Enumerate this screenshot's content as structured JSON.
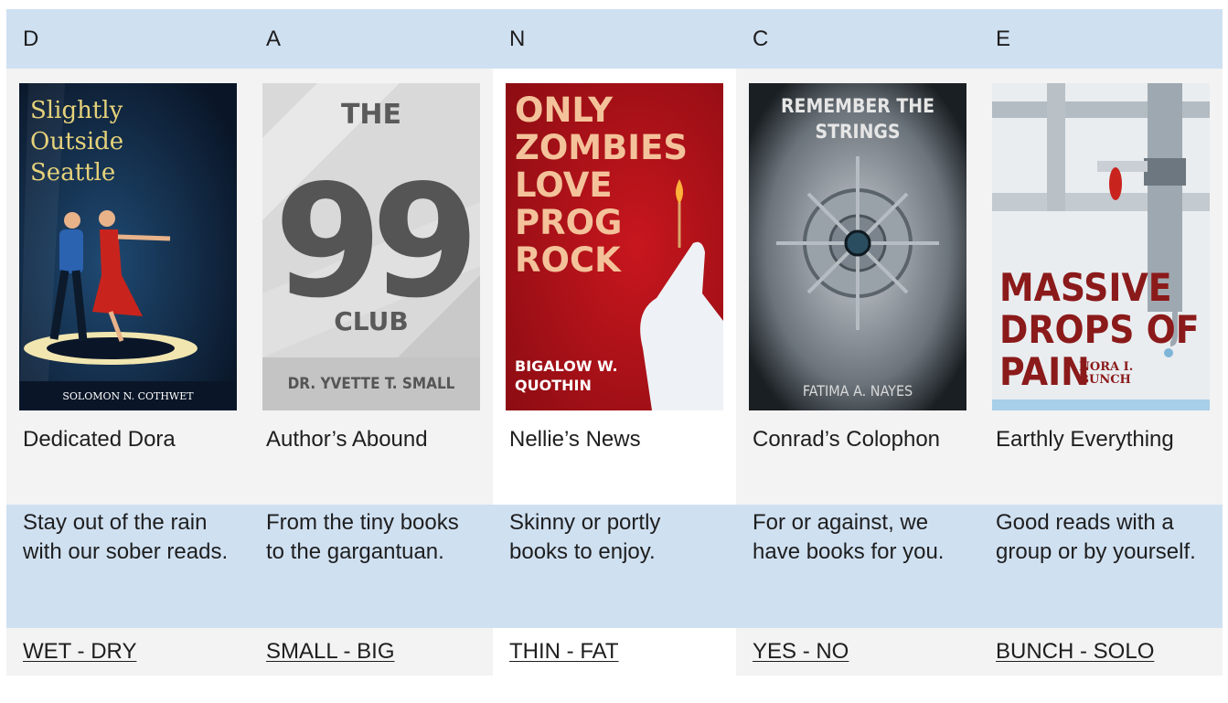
{
  "stores": [
    {
      "letter": "D",
      "name": "Dedicated Dora",
      "description": "Stay out of the rain with our sober reads.",
      "link": "WET - DRY",
      "cover": {
        "title_lines": [
          "Slightly",
          "Outside",
          "Seattle"
        ],
        "author": "SOLOMON N. COTHWET",
        "bg": "#0d2038",
        "accent": "#e6d27a"
      }
    },
    {
      "letter": "A",
      "name": "Author’s Abound",
      "description": "From the tiny books to the gargantuan.",
      "link": "SMALL - BIG",
      "cover": {
        "title_top": "THE",
        "title_big": "99",
        "title_bottom": "CLUB",
        "author": "DR. YVETTE T. SMALL",
        "bg": "#dcdcdc"
      }
    },
    {
      "letter": "N",
      "name": "Nellie’s News",
      "description": "Skinny or portly books to enjoy.",
      "link": "THIN - FAT",
      "cover": {
        "title_lines": [
          "ONLY",
          "ZOMBIES",
          "LOVE",
          "PROG",
          "ROCK"
        ],
        "author_lines": [
          "BIGALOW W.",
          "QUOTHIN"
        ],
        "bg": "#b3121a",
        "accent": "#f2c9a0"
      }
    },
    {
      "letter": "C",
      "name": "Conrad’s Colophon",
      "description": "For or against, we have books for you.",
      "link": "YES - NO",
      "cover": {
        "title_lines": [
          "REMEMBER THE",
          "STRINGS"
        ],
        "author": "FATIMA A. NAYES",
        "bg": "#1d2226"
      }
    },
    {
      "letter": "E",
      "name": "Earthly Everything",
      "description": "Good reads with a group or by yourself.",
      "link": "BUNCH - SOLO",
      "cover": {
        "title_lines": [
          "MASSIVE",
          "DROPS OF",
          "PAIN"
        ],
        "author_lines": [
          "NORA I.",
          "BUNCH"
        ],
        "bg": "#e8ecef",
        "accent": "#8b1a1a"
      }
    }
  ]
}
